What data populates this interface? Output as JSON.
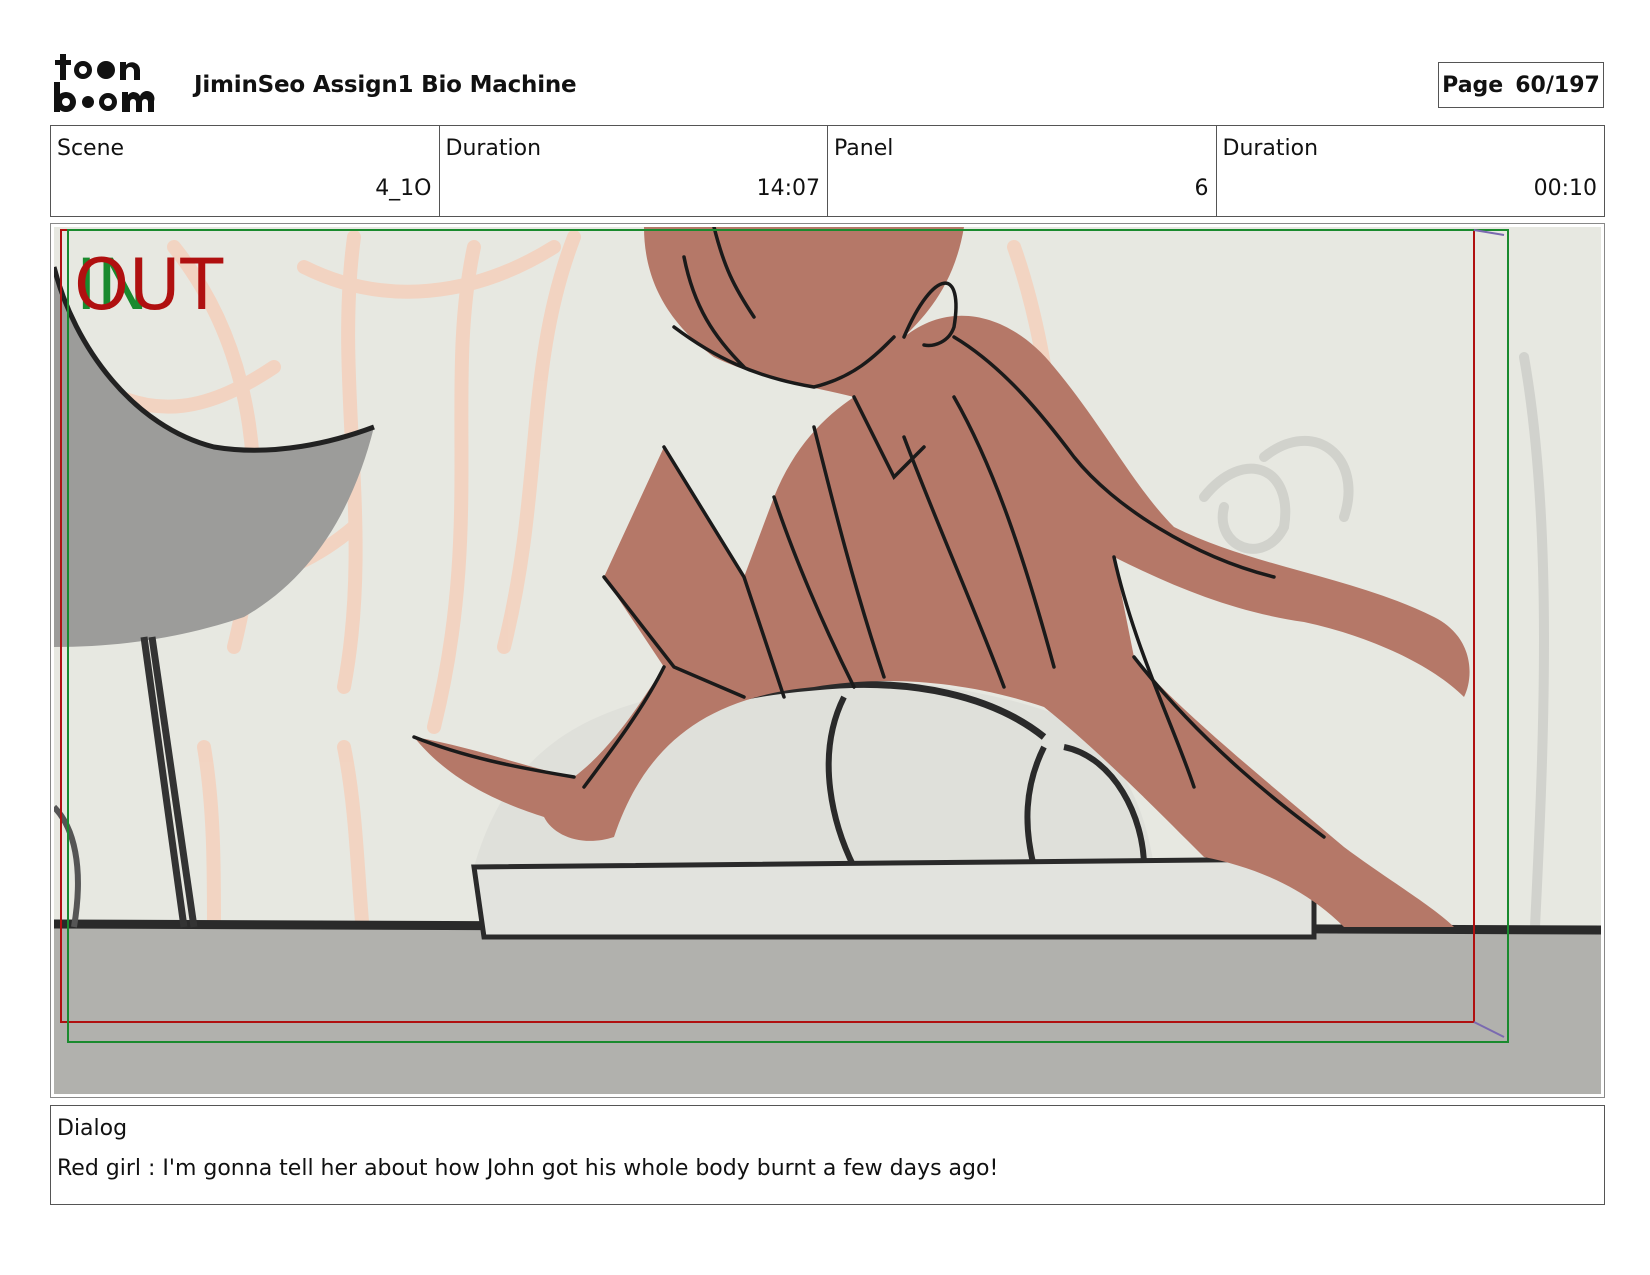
{
  "header": {
    "logo_text": "toon boom",
    "title": "JiminSeo Assign1 Bio Machine",
    "page_label": "Page",
    "page_number": "60/197"
  },
  "info": [
    {
      "label": "Scene",
      "value": "4_1O"
    },
    {
      "label": "Duration",
      "value": "14:07"
    },
    {
      "label": "Panel",
      "value": "6"
    },
    {
      "label": "Duration",
      "value": "00:10"
    }
  ],
  "frame": {
    "in_label": "IN",
    "out_label": "OUT",
    "colors": {
      "background": "#e7e8e1",
      "floor": "#b1b1ad",
      "character": "#b57868",
      "underlay": "#f6cdb7",
      "in_guide": "#1a8a2e",
      "out_guide": "#b01010"
    }
  },
  "dialog": {
    "label": "Dialog",
    "text": "Red girl : I'm gonna tell her about how John got his whole body burnt a few days ago!"
  }
}
